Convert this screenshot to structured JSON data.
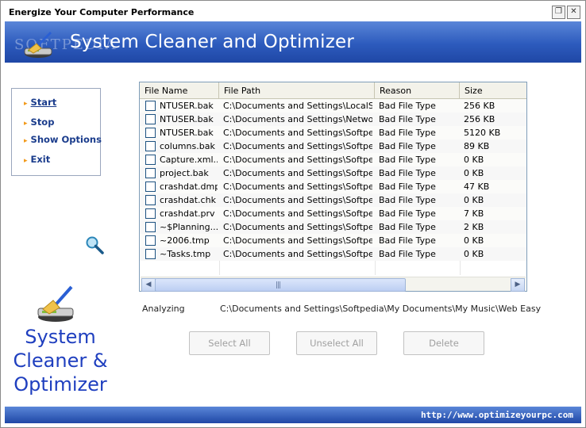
{
  "window": {
    "title": "Energize Your Computer Performance",
    "restore_glyph": "❐",
    "close_glyph": "✕"
  },
  "banner": {
    "title": "System Cleaner and Optimizer",
    "watermark": "SOFTPEDIA"
  },
  "menu": {
    "items": [
      {
        "label": "Start"
      },
      {
        "label": "Stop"
      },
      {
        "label": "Show Options"
      },
      {
        "label": "Exit"
      }
    ]
  },
  "list": {
    "columns": [
      "File Name",
      "File Path",
      "Reason",
      "Size"
    ],
    "rows": [
      {
        "name": "NTUSER.bak",
        "path": "C:\\Documents and Settings\\LocalSe...",
        "reason": "Bad File Type",
        "size": "256 KB"
      },
      {
        "name": "NTUSER.bak",
        "path": "C:\\Documents and Settings\\Networ...",
        "reason": "Bad File Type",
        "size": "256 KB"
      },
      {
        "name": "NTUSER.bak",
        "path": "C:\\Documents and Settings\\Softpedia",
        "reason": "Bad File Type",
        "size": "5120 KB"
      },
      {
        "name": "columns.bak",
        "path": "C:\\Documents and Settings\\Softpe...",
        "reason": "Bad File Type",
        "size": "89 KB"
      },
      {
        "name": "Capture.xml....",
        "path": "C:\\Documents and Settings\\Softpe...",
        "reason": "Bad File Type",
        "size": "0 KB"
      },
      {
        "name": "project.bak",
        "path": "C:\\Documents and Settings\\Softpe...",
        "reason": "Bad File Type",
        "size": "0 KB"
      },
      {
        "name": "crashdat.dmp",
        "path": "C:\\Documents and Settings\\Softpe...",
        "reason": "Bad File Type",
        "size": "47 KB"
      },
      {
        "name": "crashdat.chk",
        "path": "C:\\Documents and Settings\\Softpe...",
        "reason": "Bad File Type",
        "size": "0 KB"
      },
      {
        "name": "crashdat.prv",
        "path": "C:\\Documents and Settings\\Softpe...",
        "reason": "Bad File Type",
        "size": "7 KB"
      },
      {
        "name": "~$Planning....",
        "path": "C:\\Documents and Settings\\Softpe...",
        "reason": "Bad File Type",
        "size": "2 KB"
      },
      {
        "name": "~2006.tmp",
        "path": "C:\\Documents and Settings\\Softpe...",
        "reason": "Bad File Type",
        "size": "0 KB"
      },
      {
        "name": "~Tasks.tmp",
        "path": "C:\\Documents and Settings\\Softpe...",
        "reason": "Bad File Type",
        "size": "0 KB"
      }
    ]
  },
  "scroll": {
    "left_glyph": "◀",
    "right_glyph": "▶",
    "grip": "|||"
  },
  "status": {
    "label": "Analyzing",
    "path": "C:\\Documents and Settings\\Softpedia\\My Documents\\My Music\\Web Easy"
  },
  "actions": {
    "select_all": "Select All",
    "unselect_all": "Unselect All",
    "delete": "Delete"
  },
  "logo": {
    "line1": "System",
    "line2": "Cleaner &",
    "line3": "Optimizer"
  },
  "footer": {
    "url": "http://www.optimizeyourpc.com"
  },
  "colors": {
    "accent_blue": "#2d5bbd",
    "menu_text": "#1a3c8c",
    "menu_arrow": "#f29a1a",
    "logo_text": "#1f3fbf"
  },
  "icons": [
    "broom-drive-icon",
    "magnifier-icon",
    "restore-icon",
    "close-icon"
  ]
}
